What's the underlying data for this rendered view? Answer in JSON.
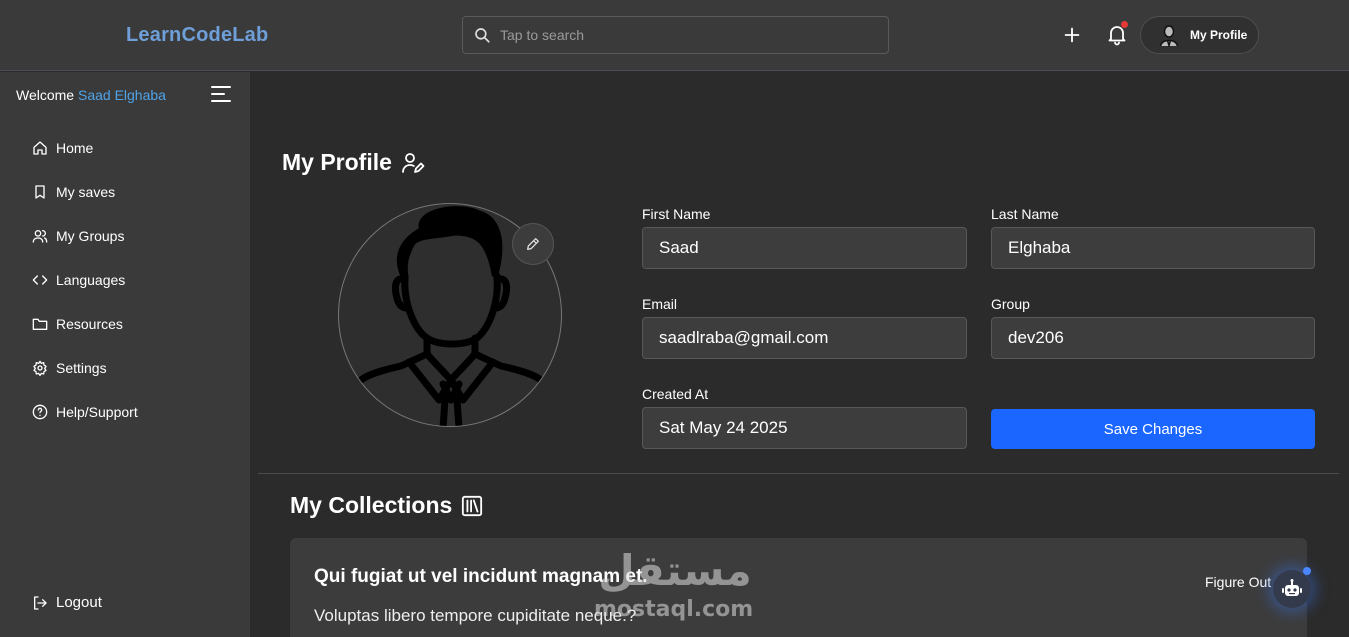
{
  "header": {
    "brand": "LearnCodeLab",
    "search_placeholder": "Tap to search",
    "add_icon": "plus-icon",
    "notification_icon": "bell-icon",
    "profile_label": "My Profile"
  },
  "sidebar": {
    "welcome_prefix": "Welcome",
    "user_name": "Saad Elghaba",
    "items": [
      {
        "label": "Home",
        "icon": "home-icon"
      },
      {
        "label": "My saves",
        "icon": "bookmark-icon"
      },
      {
        "label": "My Groups",
        "icon": "users-icon"
      },
      {
        "label": "Languages",
        "icon": "code-icon"
      },
      {
        "label": "Resources",
        "icon": "folder-icon"
      },
      {
        "label": "Settings",
        "icon": "gear-icon"
      },
      {
        "label": "Help/Support",
        "icon": "help-icon"
      }
    ],
    "logout_label": "Logout"
  },
  "profile": {
    "title": "My Profile",
    "first_name_label": "First Name",
    "first_name": "Saad",
    "last_name_label": "Last Name",
    "last_name": "Elghaba",
    "email_label": "Email",
    "email": "saadlraba@gmail.com",
    "group_label": "Group",
    "group": "dev206",
    "created_at_label": "Created At",
    "created_at": "Sat May 24 2025",
    "save_label": "Save Changes"
  },
  "collections": {
    "title": "My Collections",
    "items": [
      {
        "title": "Qui fugiat ut vel incidunt magnam et.",
        "description": "Voluptas libero tempore cupiditate neque.?",
        "action": "Figure Out"
      }
    ]
  },
  "watermark": {
    "arabic": "مستقل",
    "latin": "mostaql.com"
  },
  "colors": {
    "accent": "#1a66ff",
    "brand": "#6e9fd8",
    "user_name": "#4fa3e8",
    "notification_dot": "#e53935"
  }
}
